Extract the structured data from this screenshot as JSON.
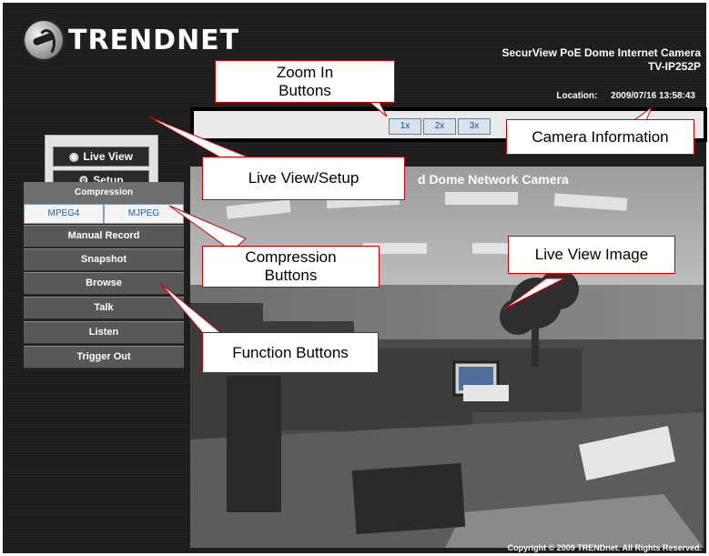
{
  "brand": {
    "logo_text": "TRENDNET",
    "logo_icon": "trendnet-globe-icon"
  },
  "product": {
    "name": "SecurView PoE Dome Internet Camera",
    "model": "TV-IP252P"
  },
  "camera_info": {
    "location_label": "Location:",
    "datetime": "2009/07/16 13:58:43"
  },
  "zoom": {
    "buttons": [
      "1x",
      "2x",
      "3x"
    ]
  },
  "mode_buttons": {
    "live_view": "Live View",
    "setup": "Setup",
    "live_view_icon": "eye-icon",
    "setup_icon": "gears-icon"
  },
  "compression": {
    "header": "Compression",
    "mpeg4": "MPEG4",
    "mjpeg": "MJPEG"
  },
  "functions": [
    "Manual Record",
    "Snapshot",
    "Browse",
    "Talk",
    "Listen",
    "Trigger Out"
  ],
  "live_view": {
    "overlay_title": "d Dome Network Camera"
  },
  "footer": {
    "copyright": "Copyright © 2009 TRENDnet. All Rights Reserved."
  },
  "callouts": {
    "zoom": "Zoom In\nButtons",
    "camera_info": "Camera Information",
    "live_view_setup": "Live View/Setup",
    "compression": "Compression\nButtons",
    "live_image": "Live View Image",
    "function": "Function Buttons"
  },
  "colors": {
    "callout_border": "#cc0000",
    "link_blue": "#1e5aa8",
    "panel_dark": "#1c1c1c"
  }
}
